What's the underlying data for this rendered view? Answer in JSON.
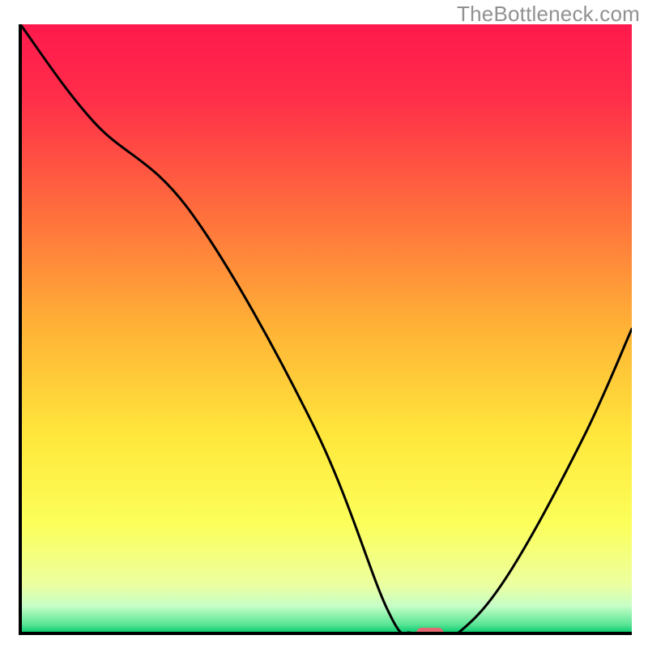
{
  "watermark": "TheBottleneck.com",
  "chart_data": {
    "type": "line",
    "title": "",
    "xlabel": "",
    "ylabel": "",
    "xlim": [
      0,
      100
    ],
    "ylim": [
      0,
      100
    ],
    "grid": false,
    "series": [
      {
        "name": "curve",
        "x": [
          0,
          12,
          28,
          48,
          60,
          64,
          68,
          72,
          80,
          92,
          100
        ],
        "y": [
          100,
          84,
          69,
          34,
          4,
          0,
          0,
          0.4,
          10,
          32,
          50
        ]
      }
    ],
    "marker": {
      "x": 67,
      "y": 0
    },
    "gradient_stops": [
      {
        "pos": 0.0,
        "color": "#ff1a4d"
      },
      {
        "pos": 0.12,
        "color": "#ff2d4a"
      },
      {
        "pos": 0.3,
        "color": "#ff6b3d"
      },
      {
        "pos": 0.5,
        "color": "#ffb336"
      },
      {
        "pos": 0.68,
        "color": "#ffe83c"
      },
      {
        "pos": 0.82,
        "color": "#fcff5a"
      },
      {
        "pos": 0.92,
        "color": "#ecffa0"
      },
      {
        "pos": 0.955,
        "color": "#c6ffc7"
      },
      {
        "pos": 0.985,
        "color": "#5be596"
      },
      {
        "pos": 1.0,
        "color": "#00c86a"
      }
    ],
    "colors": {
      "axis": "#000000",
      "curve": "#000000",
      "marker": "#e46871"
    }
  }
}
